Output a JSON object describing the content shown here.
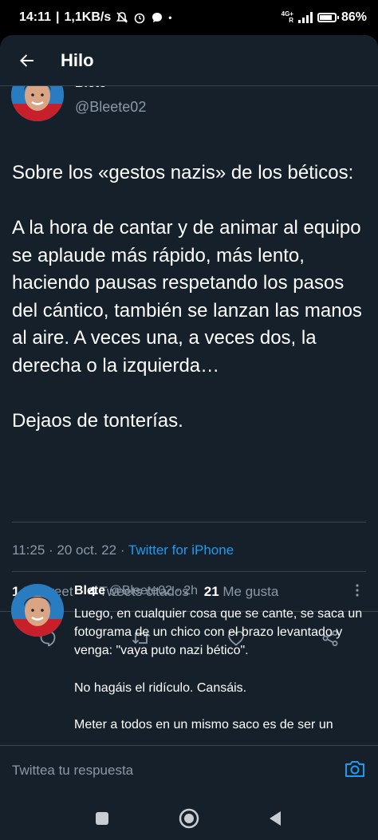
{
  "status_bar": {
    "time": "14:11",
    "speed": "1,1KB/s",
    "network": "4G+",
    "network_sub": "R",
    "battery": "86%",
    "battery_level": 0.86
  },
  "header": {
    "title": "Hilo"
  },
  "tweet": {
    "author_name": "Blete",
    "author_handle": "@Bleete02",
    "text": "Sobre los «gestos nazis» de los béticos:\n\nA la hora de cantar y de animar al equipo se aplaude más rápido, más lento, haciendo pausas respetando los pasos del cántico, también se lanzan las manos al aire. A veces una, a veces dos, la derecha o la izquierda…\n\nDejaos de tonterías.",
    "time": "11:25",
    "date": "20 oct. 22",
    "source": "Twitter for iPhone",
    "retweets_count": "1",
    "retweets_label": "Retweet",
    "quotes_count": "4",
    "quotes_label": "Tweets citados",
    "likes_count": "21",
    "likes_label": "Me gusta"
  },
  "reply": {
    "author_name": "Blete",
    "author_handle": "@Bleete02",
    "age": "2h",
    "text": "Luego, en cualquier cosa que se cante, se saca un fotograma de un chico con el brazo levantado y venga: \"vaya puto nazi bético\".\n\nNo hagáis el ridículo. Cansáis.\n\nMeter a todos en un mismo saco es de ser un"
  },
  "compose": {
    "placeholder": "Twittea tu respuesta"
  },
  "colors": {
    "background": "#15202b",
    "text_secondary": "#8b98a5",
    "accent": "#1d9bf0",
    "divider": "#38444d"
  },
  "icons": {
    "back": "arrow-left-icon",
    "reply": "speech-bubble-icon",
    "retweet": "retweet-icon",
    "like": "heart-icon",
    "share": "share-icon",
    "camera": "camera-icon"
  }
}
